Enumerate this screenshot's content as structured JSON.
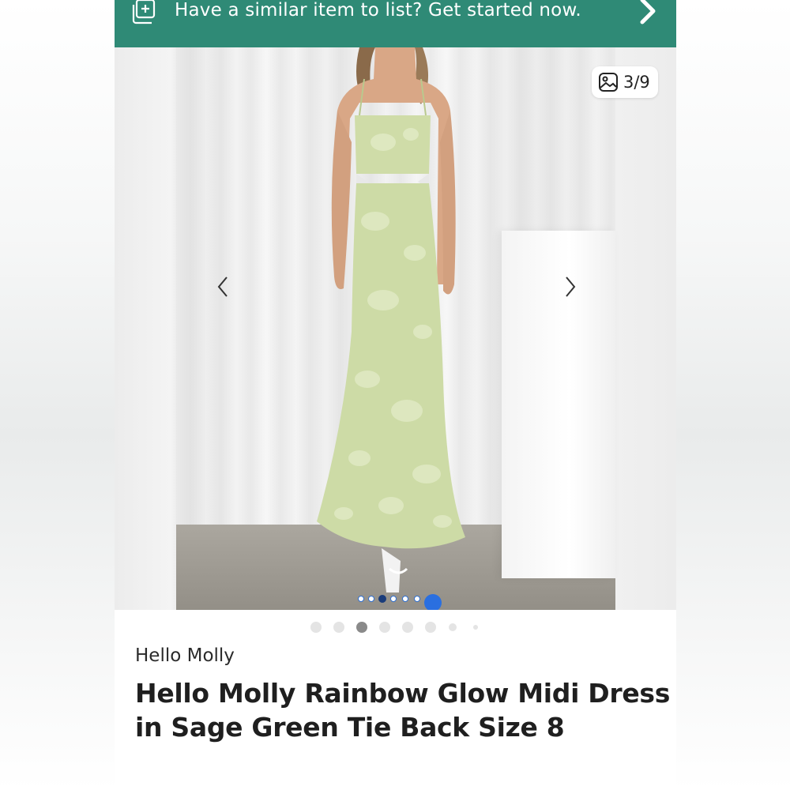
{
  "banner": {
    "text": "Have a similar item to list? Get started now.",
    "icon": "add-listing-icon",
    "chevron_icon": "chevron-right-icon",
    "background": "#2f8a76"
  },
  "gallery": {
    "counter": "3/9",
    "counter_icon": "image-icon",
    "prev_icon": "chevron-left-icon",
    "next_icon": "chevron-right-icon",
    "current_index": 3,
    "total": 9,
    "image_alt_icon": "dress-photo"
  },
  "listing": {
    "brand": "Hello Molly",
    "title": "Hello Molly Rainbow Glow Midi Dress in Sage Green Tie Back Size 8"
  },
  "colors": {
    "accent": "#2f8a76",
    "dress": "#cddba6",
    "dot_active": "#8a8a8a",
    "dot_inactive": "#e4e4e4"
  }
}
